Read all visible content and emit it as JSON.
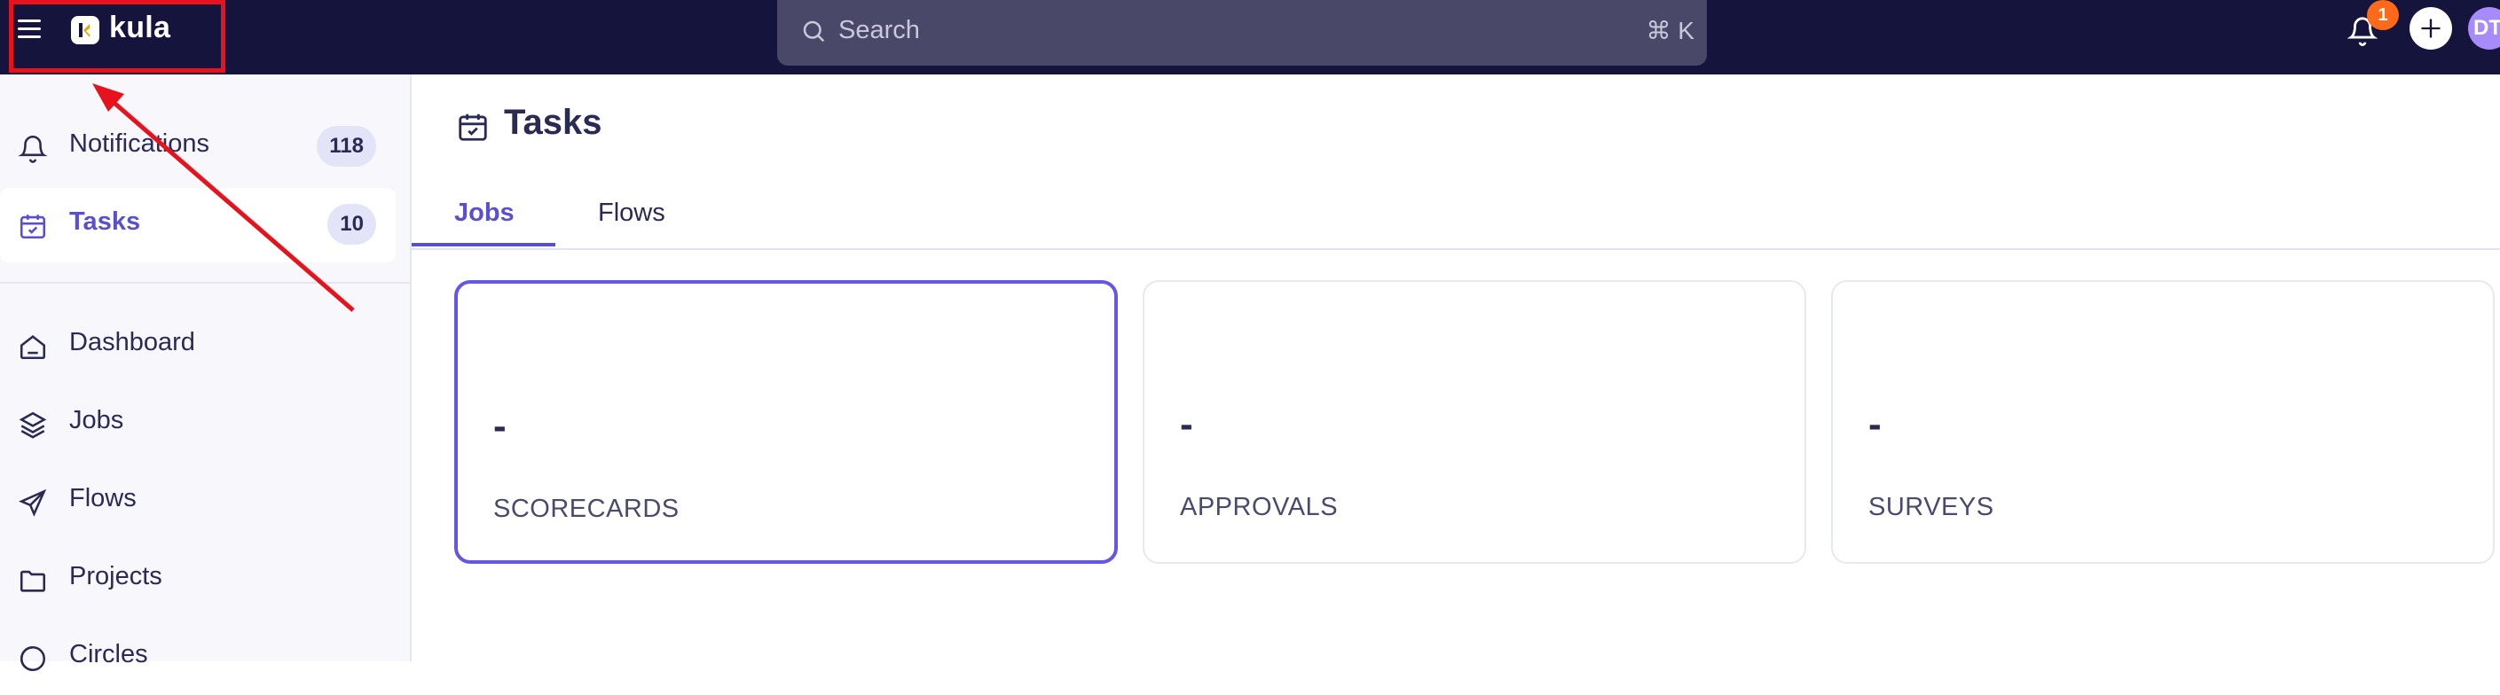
{
  "header": {
    "app_name": "kula",
    "search": {
      "placeholder": "Search",
      "shortcut": "⌘ K"
    },
    "notification_badge": "1",
    "avatar_initials": "DT"
  },
  "sidebar": {
    "items": [
      {
        "label": "Notifications",
        "count": "118",
        "icon": "bell-icon"
      },
      {
        "label": "Tasks",
        "count": "10",
        "icon": "calendar-check-icon",
        "active": true
      },
      {
        "label": "Dashboard",
        "icon": "home-icon"
      },
      {
        "label": "Jobs",
        "icon": "layers-icon"
      },
      {
        "label": "Flows",
        "icon": "send-icon"
      },
      {
        "label": "Projects",
        "icon": "folder-icon"
      },
      {
        "label": "Circles",
        "icon": "circles-icon"
      }
    ]
  },
  "main": {
    "title": "Tasks",
    "tabs": [
      {
        "label": "Jobs",
        "active": true
      },
      {
        "label": "Flows"
      }
    ],
    "cards": [
      {
        "value": "-",
        "caption": "SCORECARDS",
        "active": true
      },
      {
        "value": "-",
        "caption": "APPROVALS"
      },
      {
        "value": "-",
        "caption": "SURVEYS"
      }
    ]
  },
  "colors": {
    "topbar": "#15143d",
    "accent": "#5a4fcf",
    "highlight": "#e8121d",
    "badge": "#ff6a1a"
  }
}
